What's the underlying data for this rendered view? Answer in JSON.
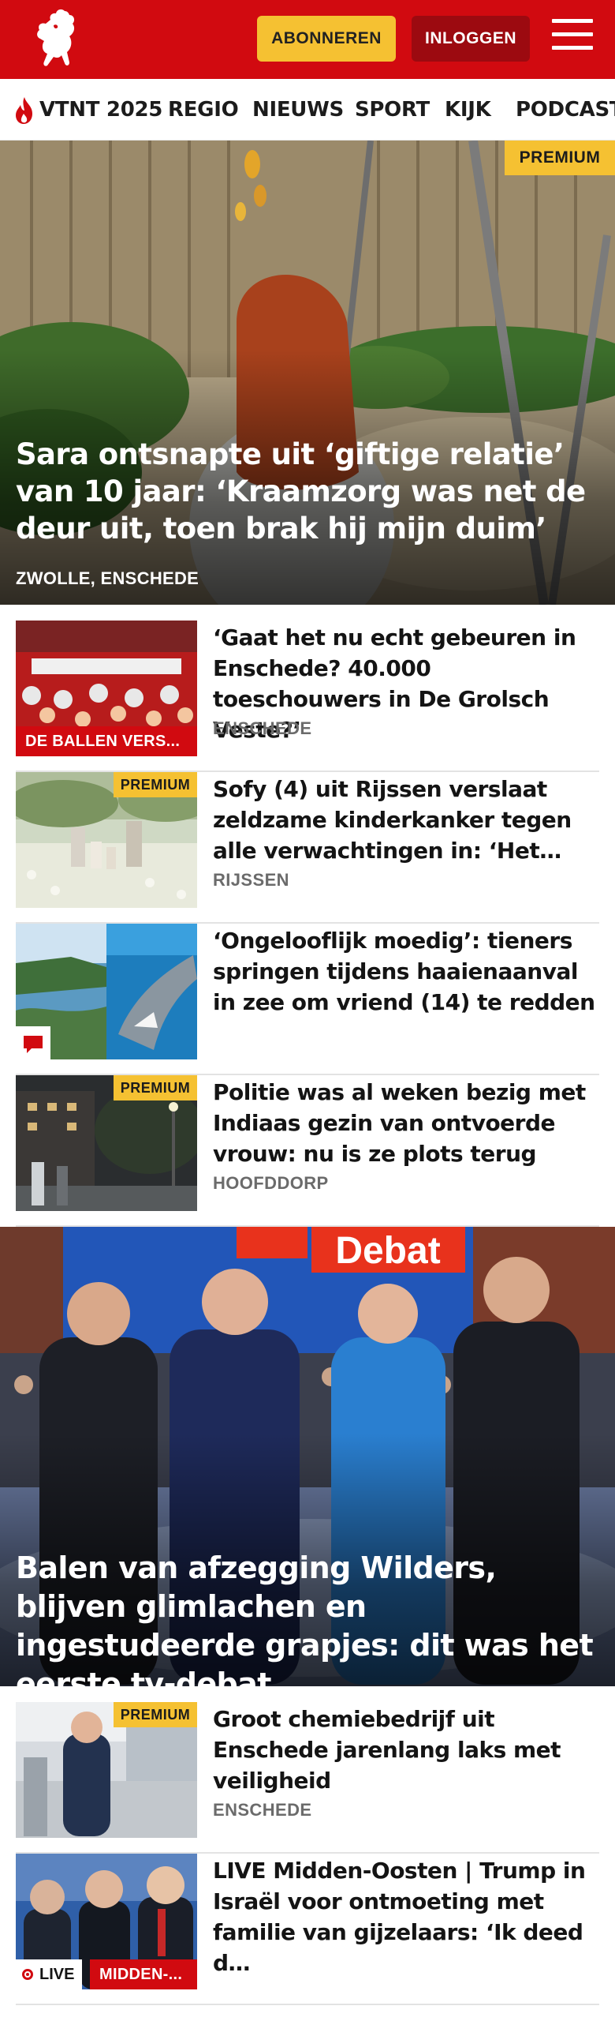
{
  "header": {
    "logo_icon": "horse-logo-icon",
    "subscribe_label": "ABONNEREN",
    "login_label": "INLOGGEN",
    "menu_icon": "hamburger-menu-icon",
    "colors": {
      "brand_red": "#d10a10",
      "subscribe_yellow": "#f5c132",
      "login_dark_red": "#9c0a10"
    }
  },
  "nav": {
    "items": [
      {
        "label": "VTNT 2025",
        "icon": "flame-icon"
      },
      {
        "label": "REGIO"
      },
      {
        "label": "NIEUWS"
      },
      {
        "label": "SPORT"
      },
      {
        "label": "KIJK"
      },
      {
        "label": "PODCAST"
      }
    ]
  },
  "hero": {
    "premium": "PREMIUM",
    "title": "Sara ontsnapte uit ‘giftige relatie’ van 10 jaar: ‘Kraamzorg was net de deur uit, toen brak hij mijn duim’",
    "location": "ZWOLLE, ENSCHEDE"
  },
  "articles": [
    {
      "title": "‘Gaat het nu echt gebeuren in Enschede? 40.000 toeschouwers in De Grolsch Veste?’",
      "location": "ENSCHEDE",
      "label": "DE BALLEN VERS..."
    },
    {
      "title": "Sofy (4) uit Rijssen verslaat zeldzame kinderkanker tegen alle verwachtingen in: ‘Het…",
      "location": "RIJSSEN",
      "premium": "PREMIUM"
    },
    {
      "title": "‘Ongelooflijk moedig’: tieners springen tijdens haaienaanval in zee om vriend (14) te redden",
      "badge_icon": "comment-icon"
    },
    {
      "title": "Politie was al weken bezig met Indiaas gezin van ontvoerde vrouw: nu is ze plots terug",
      "location": "HOOFDDORP",
      "premium": "PREMIUM"
    }
  ],
  "hero2": {
    "sign_text": "Debat",
    "title": "Balen van afzegging Wilders, blijven glimlachen en ingestudeerde grapjes: dit was het eerste tv-debat"
  },
  "articles2": [
    {
      "title": "Groot chemiebedrijf uit Enschede jarenlang laks met veiligheid",
      "location": "ENSCHEDE",
      "premium": "PREMIUM"
    },
    {
      "title": "LIVE Midden-Oosten | Trump in Israël voor ontmoeting met familie van gijzelaars: ‘Ik deed d…",
      "live_label": "LIVE",
      "label": "MIDDEN-..."
    }
  ]
}
